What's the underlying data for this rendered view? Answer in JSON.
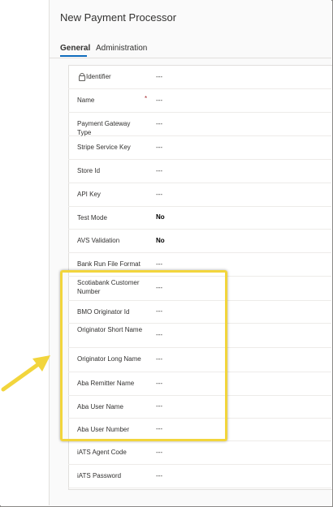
{
  "window": {
    "title": "New Payment Processor"
  },
  "tabs": [
    {
      "label": "General",
      "active": true
    },
    {
      "label": "Administration",
      "active": false
    }
  ],
  "fields": [
    {
      "label": "Identifier",
      "value": "---",
      "locked": true
    },
    {
      "label": "Name",
      "value": "---",
      "required": true,
      "required_mark": "*"
    },
    {
      "label": "Payment Gateway Type",
      "value": "---"
    },
    {
      "label": "Stripe Service Key",
      "value": "---"
    },
    {
      "label": "Store Id",
      "value": "---"
    },
    {
      "label": "API Key",
      "value": "---"
    },
    {
      "label": "Test Mode",
      "value": "No",
      "bold": true
    },
    {
      "label": "AVS Validation",
      "value": "No",
      "bold": true
    },
    {
      "label": "Bank Run File Format",
      "value": "---"
    },
    {
      "label": "Scotiabank Customer Number",
      "value": "---",
      "highlighted": true
    },
    {
      "label": "BMO Originator Id",
      "value": "---",
      "highlighted": true
    },
    {
      "label": "Originator Short Name",
      "value": "---",
      "highlighted": true
    },
    {
      "label": "Originator Long Name",
      "value": "---",
      "highlighted": true
    },
    {
      "label": "Aba Remitter Name",
      "value": "---",
      "highlighted": true
    },
    {
      "label": "Aba User Name",
      "value": "---",
      "highlighted": true
    },
    {
      "label": "Aba User Number",
      "value": "---",
      "highlighted": true
    },
    {
      "label": "iATS Agent Code",
      "value": "---"
    },
    {
      "label": "iATS Password",
      "value": "---"
    }
  ],
  "colors": {
    "accent": "#0f6cbd",
    "highlight": "#f2d53c",
    "arrow": "#f2d53c",
    "required": "#a4262c"
  },
  "icons": {
    "identifier_lock": "lock-icon",
    "callout_arrow": "arrow-icon"
  }
}
